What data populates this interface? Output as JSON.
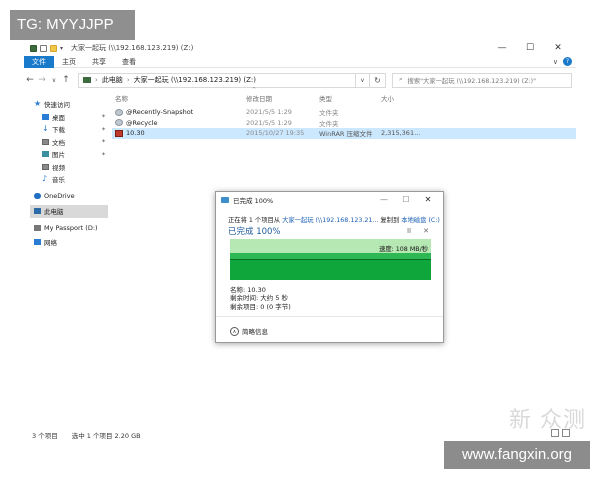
{
  "watermark_tag": "TG: MYYJJPP",
  "watermark_site": "www.fangxin.org",
  "watermark_fx": "新 众测",
  "window": {
    "title": "大家一起玩 (\\\\192.168.123.219) (Z:)",
    "controls": {
      "minimize": "—",
      "maximize": "☐",
      "close": "✕"
    }
  },
  "ribbon": {
    "tabs": [
      "文件",
      "主页",
      "共享",
      "查看"
    ],
    "help": "?",
    "expand": "∨"
  },
  "address": {
    "back": "←",
    "forward": "→",
    "recent": "∨",
    "up": "↑",
    "segments": [
      "此电脑",
      "大家一起玩 (\\\\192.168.123.219) (Z:)"
    ],
    "separator": "›",
    "dropdown": "∨",
    "refresh": "↻",
    "search_placeholder": "搜索\"大家一起玩 (\\\\192.168.123.219) (Z:)\""
  },
  "sidebar": {
    "items": [
      {
        "label": "快速访问",
        "level": 0,
        "pinned": false,
        "icon": "star-icon"
      },
      {
        "label": "桌面",
        "level": 1,
        "pinned": true,
        "icon": "desktop-icon"
      },
      {
        "label": "下载",
        "level": 1,
        "pinned": true,
        "icon": "download-icon"
      },
      {
        "label": "文档",
        "level": 1,
        "pinned": true,
        "icon": "document-icon"
      },
      {
        "label": "图片",
        "level": 1,
        "pinned": true,
        "icon": "pictures-icon"
      },
      {
        "label": "视频",
        "level": 1,
        "pinned": false,
        "icon": "video-icon"
      },
      {
        "label": "音乐",
        "level": 1,
        "pinned": false,
        "icon": "music-icon"
      },
      {
        "label": "OneDrive",
        "level": 0,
        "pinned": false,
        "icon": "onedrive-icon"
      },
      {
        "label": "此电脑",
        "level": 0,
        "pinned": false,
        "icon": "this-pc-icon",
        "selected": true
      },
      {
        "label": "My Passport (D:)",
        "level": 0,
        "pinned": false,
        "icon": "drive-icon"
      },
      {
        "label": "网络",
        "level": 0,
        "pinned": false,
        "icon": "network-icon"
      }
    ],
    "pin_glyph": "✦"
  },
  "filelist": {
    "sort_arrow": "^",
    "columns": [
      "名称",
      "修改日期",
      "类型",
      "大小"
    ],
    "rows": [
      {
        "name": "@Recently-Snapshot",
        "date": "2021/5/5 1:29",
        "type": "文件夹",
        "size": "",
        "icon": "folder-gear-icon"
      },
      {
        "name": "@Recycle",
        "date": "2021/5/5 1:29",
        "type": "文件夹",
        "size": "",
        "icon": "folder-gear-icon"
      },
      {
        "name": "10.30",
        "date": "2015/10/27 19:35",
        "type": "WinRAR 压缩文件",
        "size": "2,315,361...",
        "icon": "rar-file-icon",
        "selected": true
      }
    ]
  },
  "status": {
    "count": "3 个项目",
    "selection": "选中 1 个项目  2.20 GB"
  },
  "dialog": {
    "title": "已完成 100%",
    "line_prefix": "正在将 1 个项目从 ",
    "source": "大家一起玩 (\\\\192.168.123.21...",
    "line_mid": " 复制到 ",
    "dest": "本地磁盘 (C:)",
    "heading": "已完成 100%",
    "pause": "II",
    "cancel": "✕",
    "speed": "速度: 108 MB/秒",
    "progress": 1.0,
    "info": {
      "name": "名称: 10.30",
      "time_left": "剩余时间: 大约 5 秒",
      "items_left": "剩余项目: 0 (0 字节)"
    },
    "less_info": "简略信息",
    "less_info_icon": "∧",
    "controls": {
      "minimize": "—",
      "maximize": "☐",
      "close": "✕"
    }
  },
  "colors": {
    "accent": "#1979ca",
    "selection": "#cce8ff",
    "graph_green": "#0fa73c",
    "graph_light": "#b6e8b4"
  }
}
